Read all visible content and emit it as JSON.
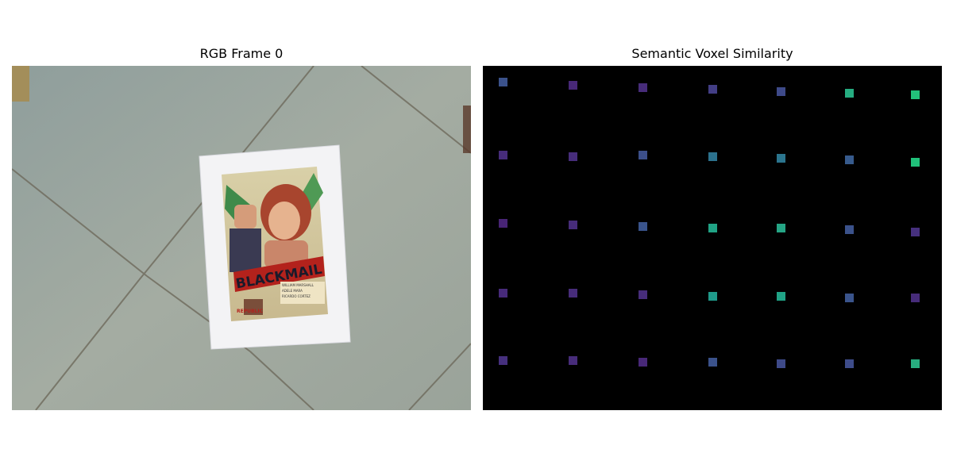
{
  "left_panel": {
    "title": "RGB Frame 0",
    "photo": {
      "subject": "poster print on paper lying on tiled floor",
      "poster_title": "BLACKMAIL",
      "poster_credits": [
        "WILLIAM MARSHALL",
        "ADELE MARA",
        "RICARDO CORTEZ"
      ],
      "poster_studio": "REPUBLIC"
    }
  },
  "right_panel": {
    "title": "Semantic Voxel Similarity",
    "background": "#000000",
    "grid_rows": 5,
    "grid_cols": 7,
    "voxel_colors": [
      [
        "#3b528b",
        "#482878",
        "#472c7a",
        "#433e85",
        "#3e4a89",
        "#26ad81",
        "#22c17a"
      ],
      [
        "#472c7a",
        "#472d7b",
        "#3c4f8a",
        "#2c728e",
        "#2b758e",
        "#375b8d",
        "#20c17a"
      ],
      [
        "#482475",
        "#472c7a",
        "#3a548c",
        "#20a385",
        "#25a585",
        "#3b528b",
        "#46307e"
      ],
      [
        "#472a7a",
        "#472c7a",
        "#472d7b",
        "#1f9a8a",
        "#20a386",
        "#3a548c",
        "#472c7a"
      ],
      [
        "#46307e",
        "#472c7a",
        "#482878",
        "#3b528b",
        "#3e4a89",
        "#3e4c8a",
        "#28ae80"
      ]
    ]
  }
}
